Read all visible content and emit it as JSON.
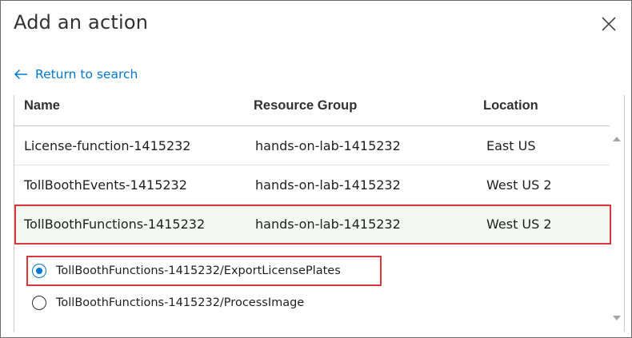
{
  "dialog": {
    "title": "Add an action",
    "close_icon": "close-icon",
    "back_link": "Return to search",
    "back_icon": "arrow-left-icon"
  },
  "table": {
    "columns": [
      "Name",
      "Resource Group",
      "Location"
    ],
    "rows": [
      {
        "name": "License-function-1415232",
        "group": "hands-on-lab-1415232",
        "location": "East US"
      },
      {
        "name": "TollBoothEvents-1415232",
        "group": "hands-on-lab-1415232",
        "location": "West US 2"
      },
      {
        "name": "TollBoothFunctions-1415232",
        "group": "hands-on-lab-1415232",
        "location": "West US 2"
      }
    ],
    "selected_row": 2
  },
  "functions": {
    "options": [
      {
        "label": "TollBoothFunctions-1415232/ExportLicensePlates",
        "checked": true
      },
      {
        "label": "TollBoothFunctions-1415232/ProcessImage",
        "checked": false
      }
    ]
  },
  "colors": {
    "accent": "#0078d4",
    "highlight": "#d9373e",
    "selected_row_bg": "#f3f9f2"
  }
}
